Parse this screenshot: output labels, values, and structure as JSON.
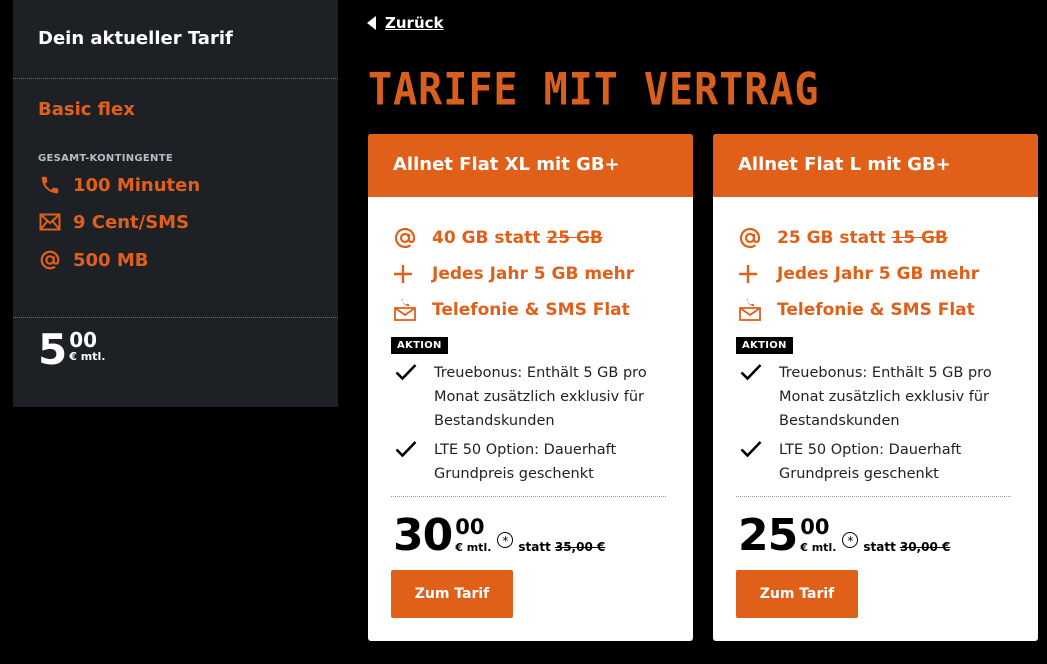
{
  "sidebar": {
    "title": "Dein aktueller Tarif",
    "plan_name": "Basic flex",
    "section_label": "GESAMT-KONTINGENTE",
    "allowances": [
      {
        "icon": "phone-icon",
        "label": "100 Minuten"
      },
      {
        "icon": "envelope-icon",
        "label": "9 Cent/SMS"
      },
      {
        "icon": "at-icon",
        "label": "500 MB"
      }
    ],
    "price": {
      "main": "5",
      "cents": "00",
      "unit": "€ mtl."
    }
  },
  "nav": {
    "back_label": "Zurück"
  },
  "page_title": "TARIFE MIT VERTRAG",
  "colors": {
    "accent": "#e0601a",
    "sidebar_bg": "#1d2126",
    "background": "#000000"
  },
  "tariffs": [
    {
      "name": "Allnet Flat XL mit GB+",
      "data_prefix": "40 GB statt",
      "data_old": "25 GB",
      "yearly": "Jedes Jahr 5 GB mehr",
      "flat": "Telefonie & SMS Flat",
      "badge": "AKTION",
      "bullets": [
        "Treuebonus: Enthält 5 GB pro Monat zusätzlich exklusiv für Bestandskunden",
        "LTE 50 Option: Dauerhaft Grundpreis geschenkt"
      ],
      "price_main": "30",
      "price_cents": "00",
      "price_unit": "€ mtl.",
      "footnote_mark": "*",
      "statt_label": "statt",
      "price_old": "35,00 €",
      "cta": "Zum Tarif"
    },
    {
      "name": "Allnet Flat L mit GB+",
      "data_prefix": "25 GB statt",
      "data_old": "15 GB",
      "yearly": "Jedes Jahr 5 GB mehr",
      "flat": "Telefonie & SMS Flat",
      "badge": "AKTION",
      "bullets": [
        "Treuebonus: Enthält 5 GB pro Monat zusätzlich exklusiv für Bestandskunden",
        "LTE 50 Option: Dauerhaft Grundpreis geschenkt"
      ],
      "price_main": "25",
      "price_cents": "00",
      "price_unit": "€ mtl.",
      "footnote_mark": "*",
      "statt_label": "statt",
      "price_old": "30,00 €",
      "cta": "Zum Tarif"
    }
  ]
}
